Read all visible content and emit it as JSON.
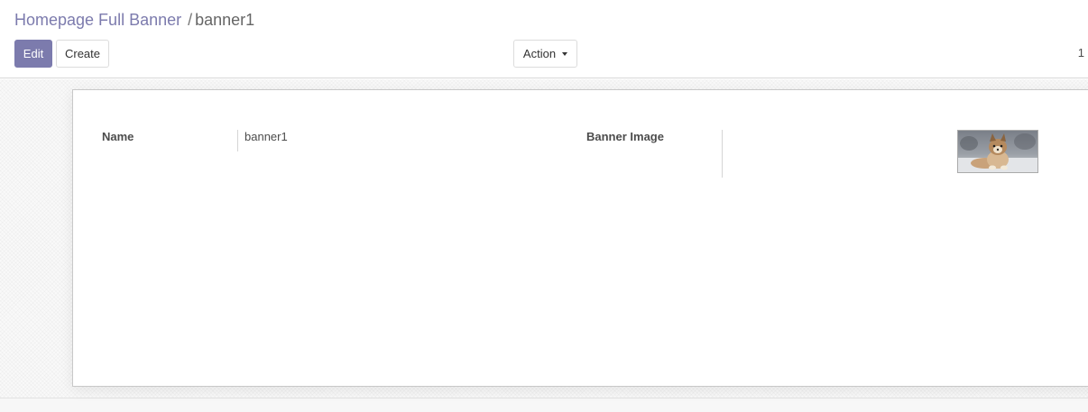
{
  "breadcrumb": {
    "parent": "Homepage Full Banner",
    "separator": "/",
    "current": "banner1"
  },
  "buttons": {
    "edit": "Edit",
    "create": "Create",
    "action": "Action"
  },
  "pager": {
    "value": "1"
  },
  "form": {
    "name_label": "Name",
    "name_value": "banner1",
    "image_label": "Banner Image",
    "image_alt": "puppy-photo"
  },
  "colors": {
    "brand": "#7c7bad",
    "text": "#4c4c4c"
  }
}
